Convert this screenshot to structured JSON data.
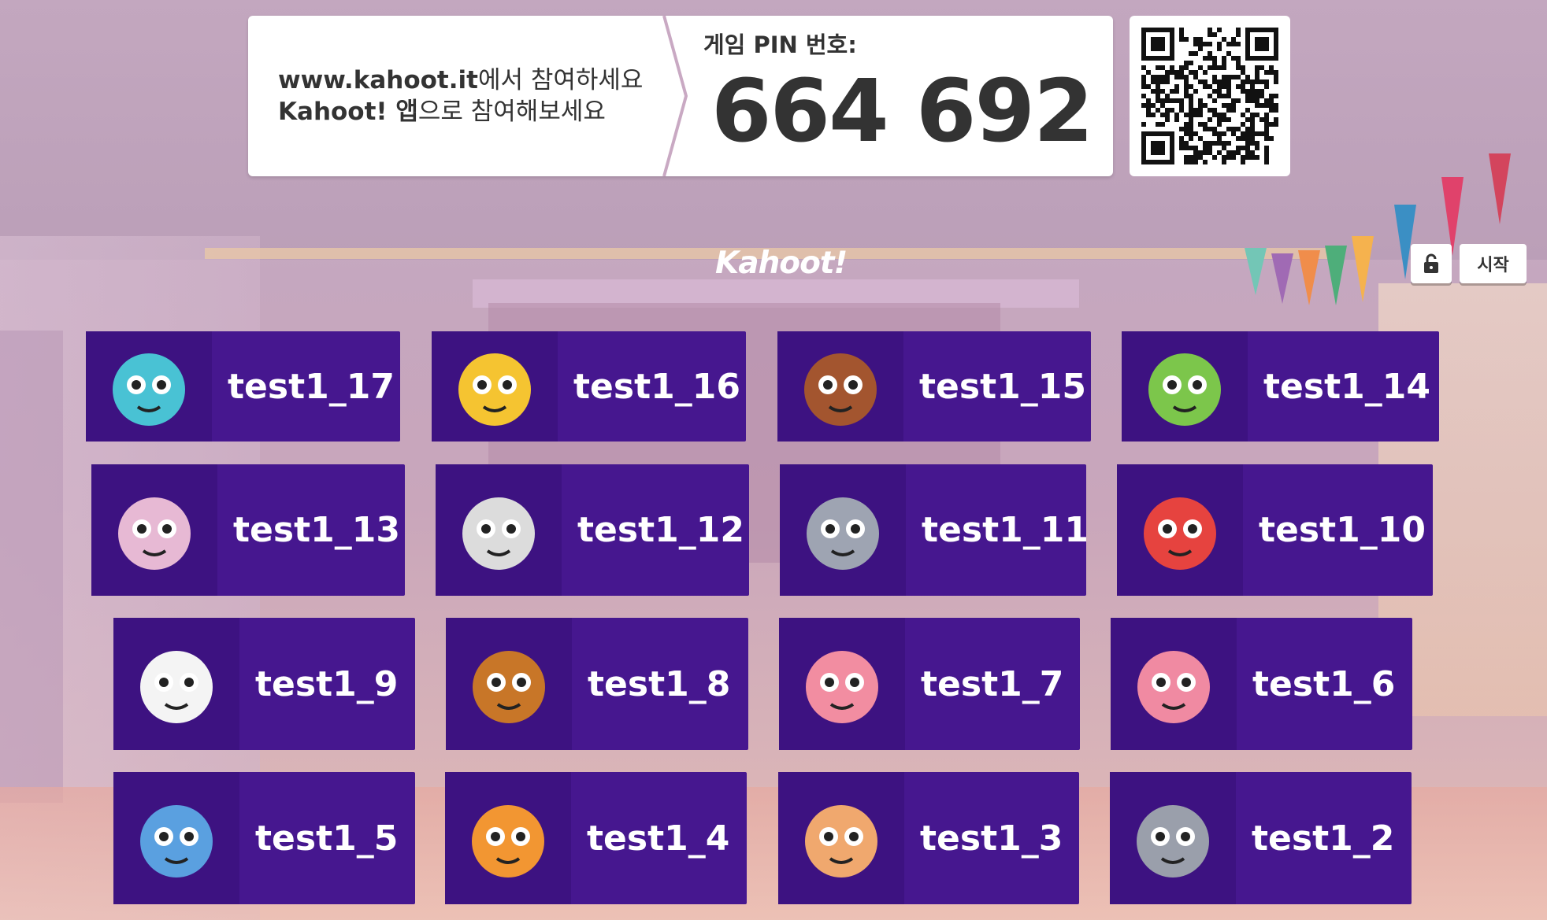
{
  "join": {
    "line1_bold": "www.kahoot.it",
    "line1_rest": "에서 참여하세요",
    "line2_bold": "Kahoot! 앱",
    "line2_rest": "으로 참여해보세요"
  },
  "pin": {
    "label": "게임 PIN 번호:",
    "number": "664 692"
  },
  "logo": "Kahoot!",
  "controls": {
    "lock_icon": "lock-open-icon",
    "start_label": "시작"
  },
  "players": [
    {
      "name": "test1_17",
      "avatar": "zombie-beanie-icon",
      "color": "#49c2d4"
    },
    {
      "name": "test1_16",
      "avatar": "duck-witch-hat-icon",
      "color": "#f5c431"
    },
    {
      "name": "test1_15",
      "avatar": "moose-monocle-icon",
      "color": "#a3552f"
    },
    {
      "name": "test1_14",
      "avatar": "dino-astronaut-icon",
      "color": "#7cc64b"
    },
    {
      "name": "test1_13",
      "avatar": "unicorn-goggles-icon",
      "color": "#e7b9d4"
    },
    {
      "name": "test1_12",
      "avatar": "polar-bear-top-hat-icon",
      "color": "#dcdcdc"
    },
    {
      "name": "test1_11",
      "avatar": "wolf-cowboy-hat-icon",
      "color": "#9ea4b2"
    },
    {
      "name": "test1_10",
      "avatar": "parrot-goggles-icon",
      "color": "#e6433f"
    },
    {
      "name": "test1_9",
      "avatar": "panda-heart-glasses-icon",
      "color": "#f4f4f4"
    },
    {
      "name": "test1_8",
      "avatar": "owl-hearts-icon",
      "color": "#c87628"
    },
    {
      "name": "test1_7",
      "avatar": "yeti-safari-hat-icon",
      "color": "#f28da1"
    },
    {
      "name": "test1_6",
      "avatar": "brain-scarf-icon",
      "color": "#f08aa2"
    },
    {
      "name": "test1_5",
      "avatar": "earth-helmet-icon",
      "color": "#5aa0e0"
    },
    {
      "name": "test1_4",
      "avatar": "cat-pompadour-icon",
      "color": "#f29632"
    },
    {
      "name": "test1_3",
      "avatar": "bear-kahoot-cap-icon",
      "color": "#f0a86e"
    },
    {
      "name": "test1_2",
      "avatar": "koala-pancakes-icon",
      "color": "#9a9fab"
    }
  ]
}
